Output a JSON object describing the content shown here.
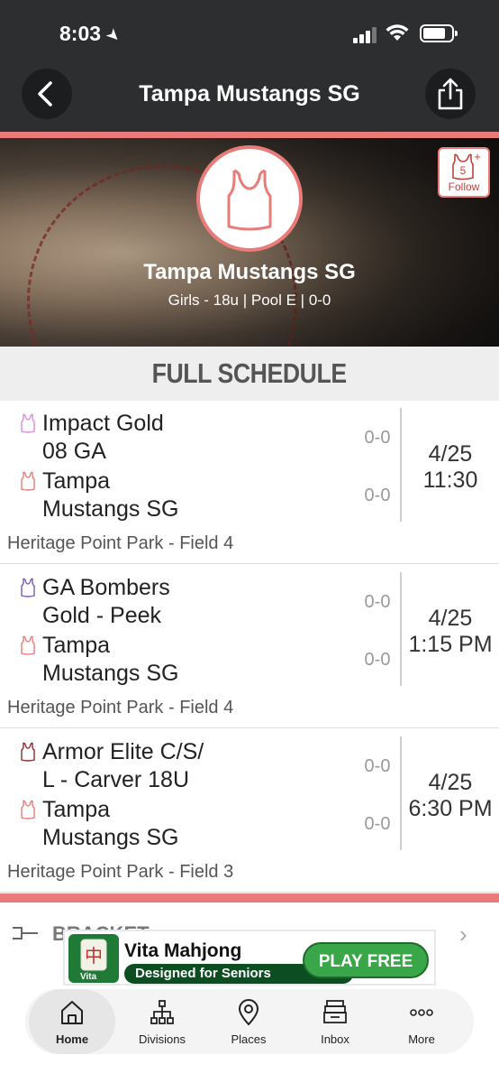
{
  "status_bar": {
    "time": "8:03"
  },
  "header": {
    "title": "Tampa Mustangs SG"
  },
  "team": {
    "name": "Tampa Mustangs SG",
    "meta": "Girls - 18u | Pool E | 0-0",
    "follow_count": "5",
    "follow_label": "Follow"
  },
  "schedule": {
    "title": "FULL SCHEDULE",
    "games": [
      {
        "team1": {
          "line1": "Impact Gold",
          "line2": "08 GA",
          "score": "0-0",
          "icon_color": "#d98ed9"
        },
        "team2": {
          "line1": "Tampa",
          "line2": "Mustangs SG",
          "score": "0-0",
          "icon_color": "#e97c78"
        },
        "date": "4/25",
        "time": "11:30",
        "venue": "Heritage Point Park - Field 4"
      },
      {
        "team1": {
          "line1": "GA Bombers",
          "line2": "Gold - Peek",
          "score": "0-0",
          "icon_color": "#7a5ab8"
        },
        "team2": {
          "line1": "Tampa",
          "line2": "Mustangs SG",
          "score": "0-0",
          "icon_color": "#e97c78"
        },
        "date": "4/25",
        "time": "1:15 PM",
        "venue": "Heritage Point Park - Field 4"
      },
      {
        "team1": {
          "line1": "Armor Elite C/S/",
          "line2": "L - Carver 18U",
          "score": "0-0",
          "icon_color": "#8a2a2a"
        },
        "team2": {
          "line1": "Tampa",
          "line2": "Mustangs SG",
          "score": "0-0",
          "icon_color": "#e97c78"
        },
        "date": "4/25",
        "time": "6:30 PM",
        "venue": "Heritage Point Park - Field 3"
      }
    ]
  },
  "bracket": {
    "label": "BRACKET"
  },
  "ad": {
    "title": "Vita Mahjong",
    "tagline": "Designed for Seniors",
    "cta": "PLAY FREE",
    "icon_label": "Vita"
  },
  "nav": {
    "items": [
      {
        "label": "Home",
        "icon": "home-icon"
      },
      {
        "label": "Divisions",
        "icon": "divisions-icon"
      },
      {
        "label": "Places",
        "icon": "places-icon"
      },
      {
        "label": "Inbox",
        "icon": "inbox-icon"
      },
      {
        "label": "More",
        "icon": "more-icon"
      }
    ]
  },
  "colors": {
    "accent": "#e97c78",
    "header_bg": "#2c2e30"
  }
}
